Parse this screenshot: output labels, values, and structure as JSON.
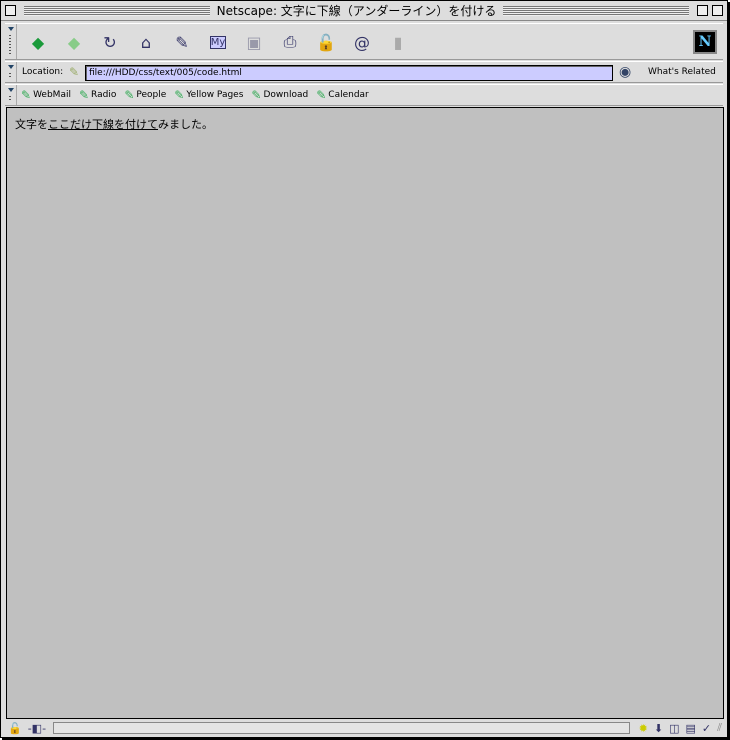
{
  "window": {
    "title": "Netscape: 文字に下線（アンダーライン）を付ける"
  },
  "toolbar": {
    "buttons": [
      {
        "name": "back-button",
        "icon": "◆",
        "color": "#1a9a3a"
      },
      {
        "name": "forward-button",
        "icon": "◆",
        "color": "#8c8"
      },
      {
        "name": "reload-button",
        "icon": "↻",
        "color": "#336"
      },
      {
        "name": "home-button",
        "icon": "⌂",
        "color": "#336"
      },
      {
        "name": "search-button",
        "icon": "✎",
        "color": "#336"
      },
      {
        "name": "my-netscape-button",
        "icon": "My",
        "color": "#336"
      },
      {
        "name": "images-button",
        "icon": "▣",
        "color": "#99a"
      },
      {
        "name": "print-button",
        "icon": "⎙",
        "color": "#336"
      },
      {
        "name": "security-button",
        "icon": "🔓",
        "color": "#c33"
      },
      {
        "name": "shop-button",
        "icon": "@",
        "color": "#336"
      },
      {
        "name": "stop-button",
        "icon": "▮",
        "color": "#aaa"
      }
    ]
  },
  "location": {
    "label": "Location:",
    "url": "file:///HDD/css/text/005/code.html",
    "related": "What's Related"
  },
  "personal_toolbar": [
    "WebMail",
    "Radio",
    "People",
    "Yellow Pages",
    "Download",
    "Calendar"
  ],
  "content": {
    "before": "文字を",
    "underlined": "ここだけ下線を付けて",
    "after": "みました。"
  }
}
